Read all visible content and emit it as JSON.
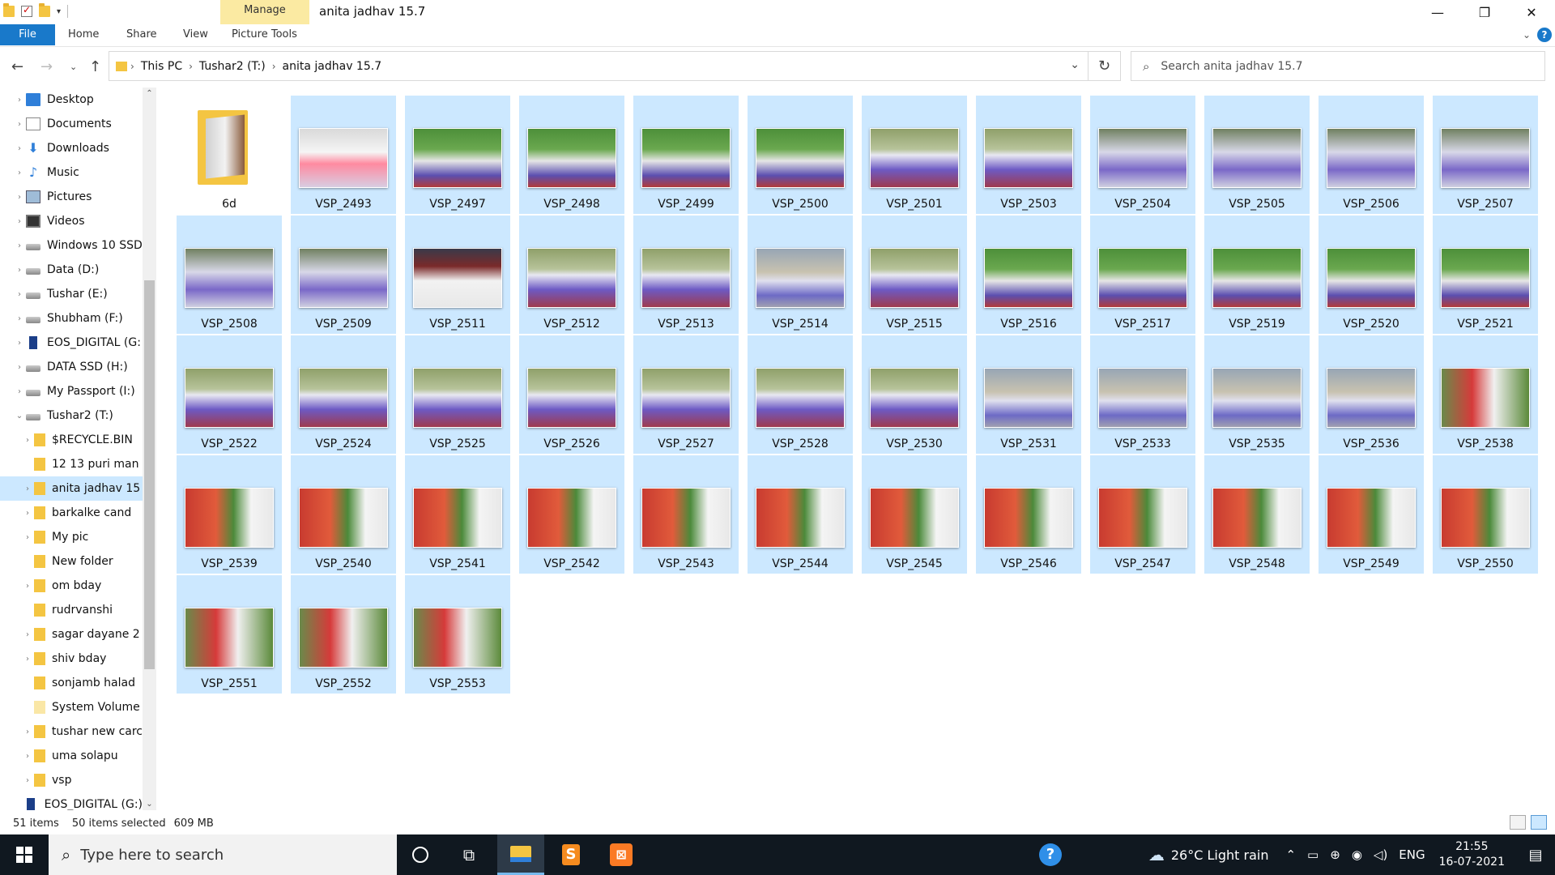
{
  "window": {
    "title": "anita jadhav 15.7",
    "contextual_tab": "Manage",
    "controls": {
      "minimize": "—",
      "maximize": "❐",
      "close": "✕"
    }
  },
  "ribbon": {
    "tabs": [
      "File",
      "Home",
      "Share",
      "View",
      "Picture Tools"
    ],
    "collapse_icon": "chevron-down-icon",
    "help": "?"
  },
  "address": {
    "breadcrumbs": [
      "This PC",
      "Tushar2 (T:)",
      "anita jadhav 15.7"
    ],
    "search_placeholder": "Search anita jadhav 15.7"
  },
  "nav": {
    "items": [
      {
        "label": "Desktop",
        "icon": "blue",
        "level": 0,
        "expander": true
      },
      {
        "label": "Documents",
        "icon": "doc",
        "level": 0,
        "expander": true
      },
      {
        "label": "Downloads",
        "icon": "down",
        "level": 0,
        "expander": true
      },
      {
        "label": "Music",
        "icon": "music",
        "level": 0,
        "expander": true
      },
      {
        "label": "Pictures",
        "icon": "pic",
        "level": 0,
        "expander": true
      },
      {
        "label": "Videos",
        "icon": "vid",
        "level": 0,
        "expander": true
      },
      {
        "label": "Windows 10 SSD",
        "icon": "drive",
        "level": 0,
        "expander": true
      },
      {
        "label": "Data (D:)",
        "icon": "drive",
        "level": 0,
        "expander": true
      },
      {
        "label": "Tushar (E:)",
        "icon": "drive",
        "level": 0,
        "expander": true
      },
      {
        "label": "Shubham (F:)",
        "icon": "drive",
        "level": 0,
        "expander": true
      },
      {
        "label": "EOS_DIGITAL (G:",
        "icon": "sd",
        "level": 0,
        "expander": true
      },
      {
        "label": "DATA SSD (H:)",
        "icon": "drive",
        "level": 0,
        "expander": true
      },
      {
        "label": "My Passport (I:)",
        "icon": "drive",
        "level": 0,
        "expander": true
      },
      {
        "label": "Tushar2 (T:)",
        "icon": "drive",
        "level": 0,
        "expander": true,
        "expanded": true
      },
      {
        "label": "$RECYCLE.BIN",
        "icon": "fold",
        "level": 1,
        "expander": true
      },
      {
        "label": "12 13 puri man",
        "icon": "fold",
        "level": 1,
        "expander": false
      },
      {
        "label": "anita jadhav 15",
        "icon": "fold",
        "level": 1,
        "expander": true,
        "selected": true
      },
      {
        "label": "barkalke cand",
        "icon": "fold",
        "level": 1,
        "expander": true
      },
      {
        "label": "My pic",
        "icon": "fold",
        "level": 1,
        "expander": true
      },
      {
        "label": "New folder",
        "icon": "fold",
        "level": 1,
        "expander": false
      },
      {
        "label": "om bday",
        "icon": "fold",
        "level": 1,
        "expander": true
      },
      {
        "label": "rudrvanshi",
        "icon": "fold",
        "level": 1,
        "expander": false
      },
      {
        "label": "sagar dayane 2",
        "icon": "fold",
        "level": 1,
        "expander": true
      },
      {
        "label": "shiv bday",
        "icon": "fold",
        "level": 1,
        "expander": true
      },
      {
        "label": "sonjamb halad",
        "icon": "fold",
        "level": 1,
        "expander": false
      },
      {
        "label": "System Volume",
        "icon": "foldsys",
        "level": 1,
        "expander": false
      },
      {
        "label": "tushar new carc",
        "icon": "fold",
        "level": 1,
        "expander": true
      },
      {
        "label": "uma solapu",
        "icon": "fold",
        "level": 1,
        "expander": true
      },
      {
        "label": "vsp",
        "icon": "fold",
        "level": 1,
        "expander": true
      },
      {
        "label": "EOS_DIGITAL (G:)",
        "icon": "sd",
        "level": 0,
        "expander": false
      }
    ]
  },
  "files": [
    {
      "name": "6d",
      "type": "folder",
      "selected": false
    },
    {
      "name": "VSP_2493",
      "thumb": "stage",
      "selected": true
    },
    {
      "name": "VSP_2497",
      "thumb": "green",
      "selected": true
    },
    {
      "name": "VSP_2498",
      "thumb": "green",
      "selected": true
    },
    {
      "name": "VSP_2499",
      "thumb": "green",
      "selected": true
    },
    {
      "name": "VSP_2500",
      "thumb": "green",
      "selected": true
    },
    {
      "name": "VSP_2501",
      "thumb": "crowd",
      "selected": true
    },
    {
      "name": "VSP_2503",
      "thumb": "crowd",
      "selected": true
    },
    {
      "name": "VSP_2504",
      "thumb": "table",
      "selected": true
    },
    {
      "name": "VSP_2505",
      "thumb": "table",
      "selected": true
    },
    {
      "name": "VSP_2506",
      "thumb": "table",
      "selected": true
    },
    {
      "name": "VSP_2507",
      "thumb": "table",
      "selected": true
    },
    {
      "name": "VSP_2508",
      "thumb": "table",
      "selected": true
    },
    {
      "name": "VSP_2509",
      "thumb": "table",
      "selected": true
    },
    {
      "name": "VSP_2511",
      "thumb": "man",
      "selected": true
    },
    {
      "name": "VSP_2512",
      "thumb": "crowd",
      "selected": true
    },
    {
      "name": "VSP_2513",
      "thumb": "crowd",
      "selected": true
    },
    {
      "name": "VSP_2514",
      "thumb": "field",
      "selected": true
    },
    {
      "name": "VSP_2515",
      "thumb": "crowd",
      "selected": true
    },
    {
      "name": "VSP_2516",
      "thumb": "green",
      "selected": true
    },
    {
      "name": "VSP_2517",
      "thumb": "green",
      "selected": true
    },
    {
      "name": "VSP_2519",
      "thumb": "green",
      "selected": true
    },
    {
      "name": "VSP_2520",
      "thumb": "green",
      "selected": true
    },
    {
      "name": "VSP_2521",
      "thumb": "green",
      "selected": true
    },
    {
      "name": "VSP_2522",
      "thumb": "crowd",
      "selected": true
    },
    {
      "name": "VSP_2524",
      "thumb": "crowd",
      "selected": true
    },
    {
      "name": "VSP_2525",
      "thumb": "crowd",
      "selected": true
    },
    {
      "name": "VSP_2526",
      "thumb": "crowd",
      "selected": true
    },
    {
      "name": "VSP_2527",
      "thumb": "crowd",
      "selected": true
    },
    {
      "name": "VSP_2528",
      "thumb": "crowd",
      "selected": true
    },
    {
      "name": "VSP_2530",
      "thumb": "crowd",
      "selected": true
    },
    {
      "name": "VSP_2531",
      "thumb": "field",
      "selected": true
    },
    {
      "name": "VSP_2533",
      "thumb": "field",
      "selected": true
    },
    {
      "name": "VSP_2535",
      "thumb": "field",
      "selected": true
    },
    {
      "name": "VSP_2536",
      "thumb": "field",
      "selected": true
    },
    {
      "name": "VSP_2538",
      "thumb": "couple",
      "selected": true
    },
    {
      "name": "VSP_2539",
      "thumb": "handover",
      "selected": true
    },
    {
      "name": "VSP_2540",
      "thumb": "handover",
      "selected": true
    },
    {
      "name": "VSP_2541",
      "thumb": "handover",
      "selected": true
    },
    {
      "name": "VSP_2542",
      "thumb": "handover",
      "selected": true
    },
    {
      "name": "VSP_2543",
      "thumb": "handover",
      "selected": true
    },
    {
      "name": "VSP_2544",
      "thumb": "handover",
      "selected": true
    },
    {
      "name": "VSP_2545",
      "thumb": "handover",
      "selected": true
    },
    {
      "name": "VSP_2546",
      "thumb": "handover",
      "selected": true
    },
    {
      "name": "VSP_2547",
      "thumb": "handover",
      "selected": true
    },
    {
      "name": "VSP_2548",
      "thumb": "handover",
      "selected": true
    },
    {
      "name": "VSP_2549",
      "thumb": "handover",
      "selected": true
    },
    {
      "name": "VSP_2550",
      "thumb": "handover",
      "selected": true
    },
    {
      "name": "VSP_2551",
      "thumb": "couple",
      "selected": true
    },
    {
      "name": "VSP_2552",
      "thumb": "couple",
      "selected": true
    },
    {
      "name": "VSP_2553",
      "thumb": "couple",
      "selected": true
    }
  ],
  "status": {
    "item_count": "51 items",
    "selection": "50 items selected",
    "size": "609 MB"
  },
  "taskbar": {
    "search_placeholder": "Type here to search",
    "weather_temp": "26°C",
    "weather_text": "Light rain",
    "language": "ENG",
    "time": "21:55",
    "date": "16-07-2021"
  },
  "colors": {
    "accent": "#1979ca",
    "selection": "#cce8ff",
    "manage_tab": "#fbeaa2",
    "taskbar": "#101820"
  }
}
